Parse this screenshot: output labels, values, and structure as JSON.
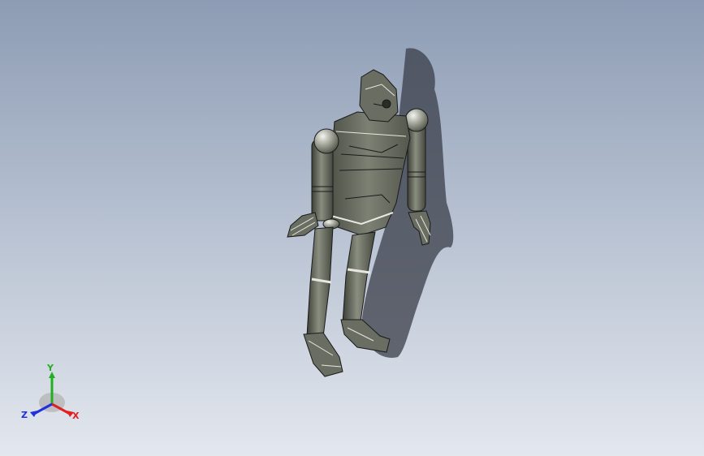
{
  "viewport": {
    "background_top": "#8d9cb4",
    "background_bottom": "#e3e7ee",
    "model": {
      "body_color": "#62665a",
      "edge_color": "#1a1a1a",
      "highlight_color": "#e8e8e0"
    }
  },
  "triad": {
    "x_label": "X",
    "y_label": "Y",
    "z_label": "Z",
    "x_color": "#e02020",
    "y_color": "#22b022",
    "z_color": "#2030e0"
  }
}
